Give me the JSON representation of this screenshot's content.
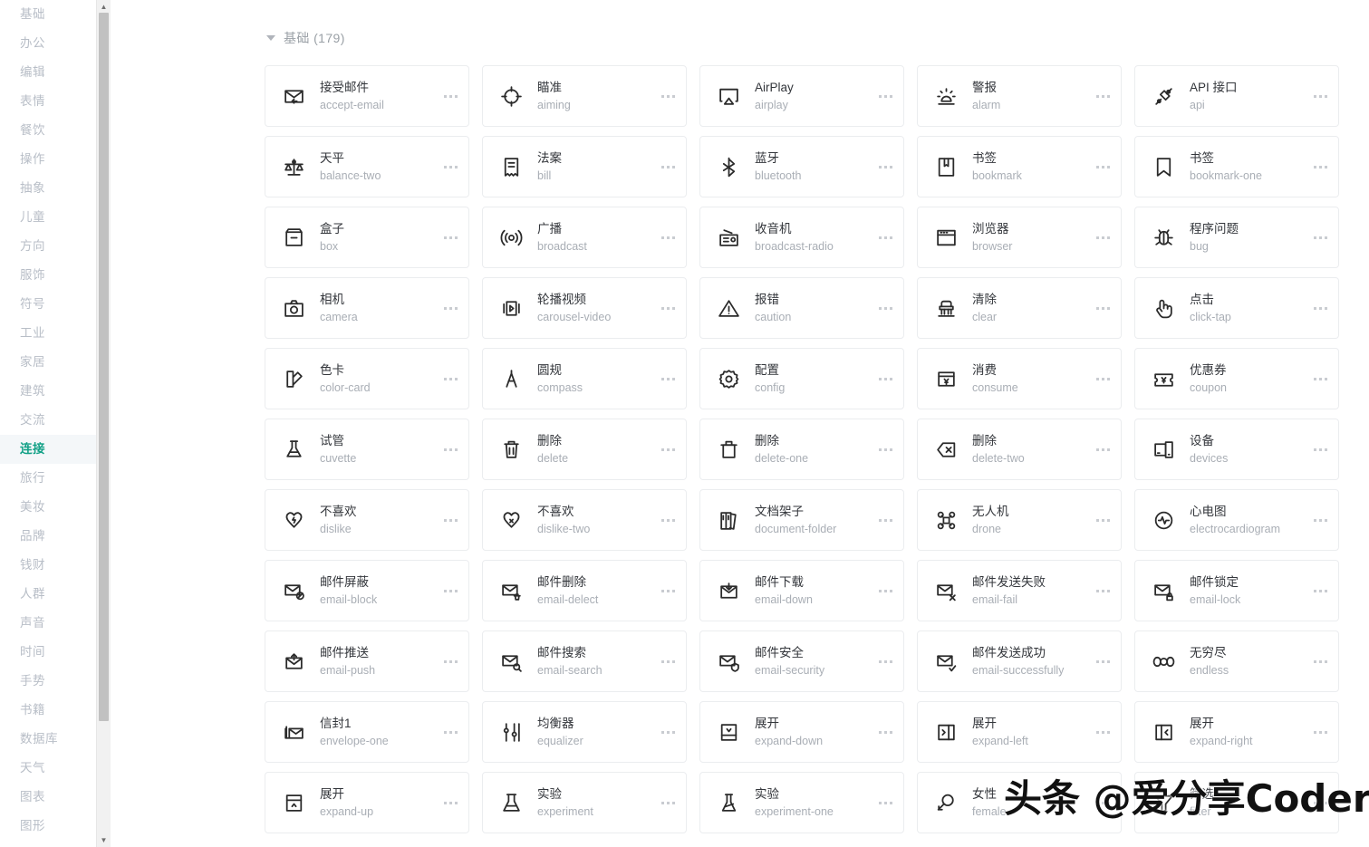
{
  "colors": {
    "accent": "#11a086",
    "card_border": "#ebedef",
    "text_primary": "#33363b",
    "text_secondary": "#a9aeb5",
    "sidebar_text": "#b8bec7",
    "sidebar_active_bg": "#f4f7f9"
  },
  "sidebar": {
    "items": [
      {
        "label": "基础",
        "active": false
      },
      {
        "label": "办公",
        "active": false
      },
      {
        "label": "编辑",
        "active": false
      },
      {
        "label": "表情",
        "active": false
      },
      {
        "label": "餐饮",
        "active": false
      },
      {
        "label": "操作",
        "active": false
      },
      {
        "label": "抽象",
        "active": false
      },
      {
        "label": "儿童",
        "active": false
      },
      {
        "label": "方向",
        "active": false
      },
      {
        "label": "服饰",
        "active": false
      },
      {
        "label": "符号",
        "active": false
      },
      {
        "label": "工业",
        "active": false
      },
      {
        "label": "家居",
        "active": false
      },
      {
        "label": "建筑",
        "active": false
      },
      {
        "label": "交流",
        "active": false
      },
      {
        "label": "连接",
        "active": true
      },
      {
        "label": "旅行",
        "active": false
      },
      {
        "label": "美妆",
        "active": false
      },
      {
        "label": "品牌",
        "active": false
      },
      {
        "label": "钱财",
        "active": false
      },
      {
        "label": "人群",
        "active": false
      },
      {
        "label": "声音",
        "active": false
      },
      {
        "label": "时间",
        "active": false
      },
      {
        "label": "手势",
        "active": false
      },
      {
        "label": "书籍",
        "active": false
      },
      {
        "label": "数据库",
        "active": false
      },
      {
        "label": "天气",
        "active": false
      },
      {
        "label": "图表",
        "active": false
      },
      {
        "label": "图形",
        "active": false
      }
    ],
    "scrollbar": {
      "up_arrow": "▲",
      "down_arrow": "▼"
    }
  },
  "main": {
    "group_title": "基础 (179)",
    "cards": [
      {
        "cn": "接受邮件",
        "en": "accept-email",
        "icon": "accept-email-icon"
      },
      {
        "cn": "瞄准",
        "en": "aiming",
        "icon": "aiming-icon"
      },
      {
        "cn": "AirPlay",
        "en": "airplay",
        "icon": "airplay-icon"
      },
      {
        "cn": "警报",
        "en": "alarm",
        "icon": "alarm-icon"
      },
      {
        "cn": "API 接口",
        "en": "api",
        "icon": "api-icon"
      },
      {
        "cn": "天平",
        "en": "balance-two",
        "icon": "balance-two-icon"
      },
      {
        "cn": "法案",
        "en": "bill",
        "icon": "bill-icon"
      },
      {
        "cn": "蓝牙",
        "en": "bluetooth",
        "icon": "bluetooth-icon"
      },
      {
        "cn": "书签",
        "en": "bookmark",
        "icon": "bookmark-icon"
      },
      {
        "cn": "书签",
        "en": "bookmark-one",
        "icon": "bookmark-one-icon"
      },
      {
        "cn": "盒子",
        "en": "box",
        "icon": "box-icon"
      },
      {
        "cn": "广播",
        "en": "broadcast",
        "icon": "broadcast-icon"
      },
      {
        "cn": "收音机",
        "en": "broadcast-radio",
        "icon": "broadcast-radio-icon"
      },
      {
        "cn": "浏览器",
        "en": "browser",
        "icon": "browser-icon"
      },
      {
        "cn": "程序问题",
        "en": "bug",
        "icon": "bug-icon"
      },
      {
        "cn": "相机",
        "en": "camera",
        "icon": "camera-icon"
      },
      {
        "cn": "轮播视频",
        "en": "carousel-video",
        "icon": "carousel-video-icon"
      },
      {
        "cn": "报错",
        "en": "caution",
        "icon": "caution-icon"
      },
      {
        "cn": "清除",
        "en": "clear",
        "icon": "clear-icon"
      },
      {
        "cn": "点击",
        "en": "click-tap",
        "icon": "click-tap-icon"
      },
      {
        "cn": "色卡",
        "en": "color-card",
        "icon": "color-card-icon"
      },
      {
        "cn": "圆规",
        "en": "compass",
        "icon": "compass-icon"
      },
      {
        "cn": "配置",
        "en": "config",
        "icon": "config-icon"
      },
      {
        "cn": "消费",
        "en": "consume",
        "icon": "consume-icon"
      },
      {
        "cn": "优惠券",
        "en": "coupon",
        "icon": "coupon-icon"
      },
      {
        "cn": "试管",
        "en": "cuvette",
        "icon": "cuvette-icon"
      },
      {
        "cn": "删除",
        "en": "delete",
        "icon": "delete-icon"
      },
      {
        "cn": "删除",
        "en": "delete-one",
        "icon": "delete-one-icon"
      },
      {
        "cn": "删除",
        "en": "delete-two",
        "icon": "delete-two-icon"
      },
      {
        "cn": "设备",
        "en": "devices",
        "icon": "devices-icon"
      },
      {
        "cn": "不喜欢",
        "en": "dislike",
        "icon": "dislike-icon"
      },
      {
        "cn": "不喜欢",
        "en": "dislike-two",
        "icon": "dislike-two-icon"
      },
      {
        "cn": "文档架子",
        "en": "document-folder",
        "icon": "document-folder-icon"
      },
      {
        "cn": "无人机",
        "en": "drone",
        "icon": "drone-icon"
      },
      {
        "cn": "心电图",
        "en": "electrocardiogram",
        "icon": "electrocardiogram-icon"
      },
      {
        "cn": "邮件屏蔽",
        "en": "email-block",
        "icon": "email-block-icon"
      },
      {
        "cn": "邮件删除",
        "en": "email-delect",
        "icon": "email-delect-icon"
      },
      {
        "cn": "邮件下载",
        "en": "email-down",
        "icon": "email-down-icon"
      },
      {
        "cn": "邮件发送失败",
        "en": "email-fail",
        "icon": "email-fail-icon"
      },
      {
        "cn": "邮件锁定",
        "en": "email-lock",
        "icon": "email-lock-icon"
      },
      {
        "cn": "邮件推送",
        "en": "email-push",
        "icon": "email-push-icon"
      },
      {
        "cn": "邮件搜索",
        "en": "email-search",
        "icon": "email-search-icon"
      },
      {
        "cn": "邮件安全",
        "en": "email-security",
        "icon": "email-security-icon"
      },
      {
        "cn": "邮件发送成功",
        "en": "email-successfully",
        "icon": "email-successfully-icon"
      },
      {
        "cn": "无穷尽",
        "en": "endless",
        "icon": "endless-icon"
      },
      {
        "cn": "信封1",
        "en": "envelope-one",
        "icon": "envelope-one-icon"
      },
      {
        "cn": "均衡器",
        "en": "equalizer",
        "icon": "equalizer-icon"
      },
      {
        "cn": "展开",
        "en": "expand-down",
        "icon": "expand-down-icon"
      },
      {
        "cn": "展开",
        "en": "expand-left",
        "icon": "expand-left-icon"
      },
      {
        "cn": "展开",
        "en": "expand-right",
        "icon": "expand-right-icon"
      },
      {
        "cn": "展开",
        "en": "expand-up",
        "icon": "expand-up-icon"
      },
      {
        "cn": "实验",
        "en": "experiment",
        "icon": "experiment-icon"
      },
      {
        "cn": "实验",
        "en": "experiment-one",
        "icon": "experiment-one-icon"
      },
      {
        "cn": "女性",
        "en": "female",
        "icon": "female-icon"
      },
      {
        "cn": "筛选",
        "en": "filter",
        "icon": "filter-icon"
      }
    ]
  },
  "watermark": {
    "text": "头条 @爱分享Coder"
  }
}
